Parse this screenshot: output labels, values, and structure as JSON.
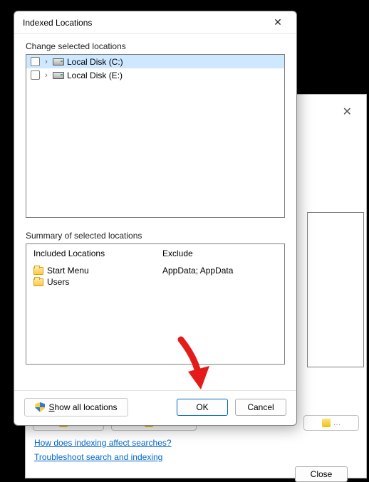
{
  "modal": {
    "title": "Indexed Locations",
    "sections": {
      "change_label": "Change selected locations",
      "summary_label": "Summary of selected locations"
    },
    "tree": [
      {
        "label": "Local Disk (C:)",
        "selected": true
      },
      {
        "label": "Local Disk (E:)",
        "selected": false
      }
    ],
    "summary": {
      "included_header": "Included Locations",
      "exclude_header": "Exclude",
      "included": [
        "Start Menu",
        "Users"
      ],
      "exclude_text": "AppData; AppData"
    },
    "buttons": {
      "show_all": "Show all locations",
      "ok": "OK",
      "cancel": "Cancel"
    }
  },
  "back": {
    "links": {
      "how": "How does indexing affect searches?",
      "troubleshoot": "Troubleshoot search and indexing"
    },
    "close": "Close"
  }
}
